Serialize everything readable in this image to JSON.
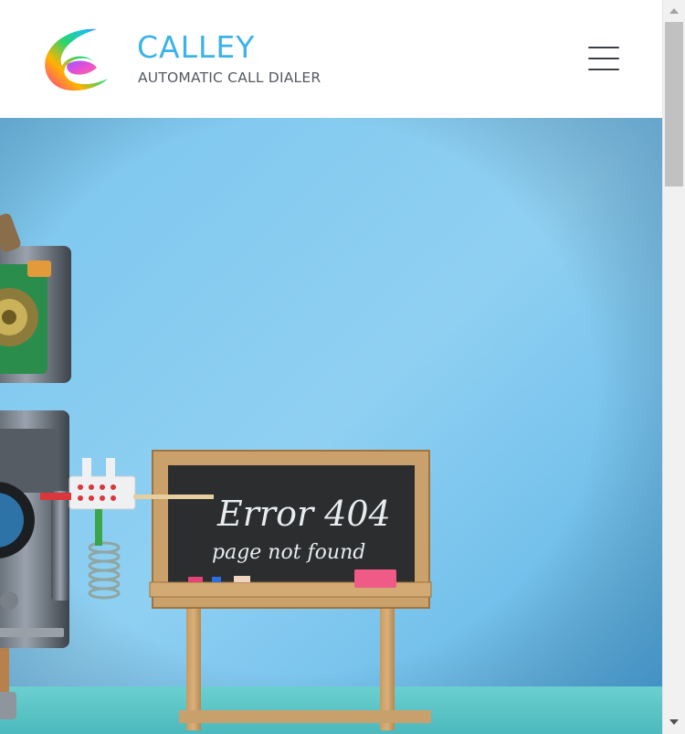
{
  "header": {
    "brand_name": "CALLEY",
    "tagline": "AUTOMATIC CALL DIALER",
    "logo_icon": "calley-swirl-logo",
    "menu_icon": "hamburger-menu-icon"
  },
  "hero": {
    "chalkboard_line1": "Error 404",
    "chalkboard_line2": "page not found",
    "background_color": "#8ccdf0"
  },
  "colors": {
    "brand_accent": "#3ab3e8",
    "tagline": "#555a60",
    "header_bg": "#ffffff"
  }
}
